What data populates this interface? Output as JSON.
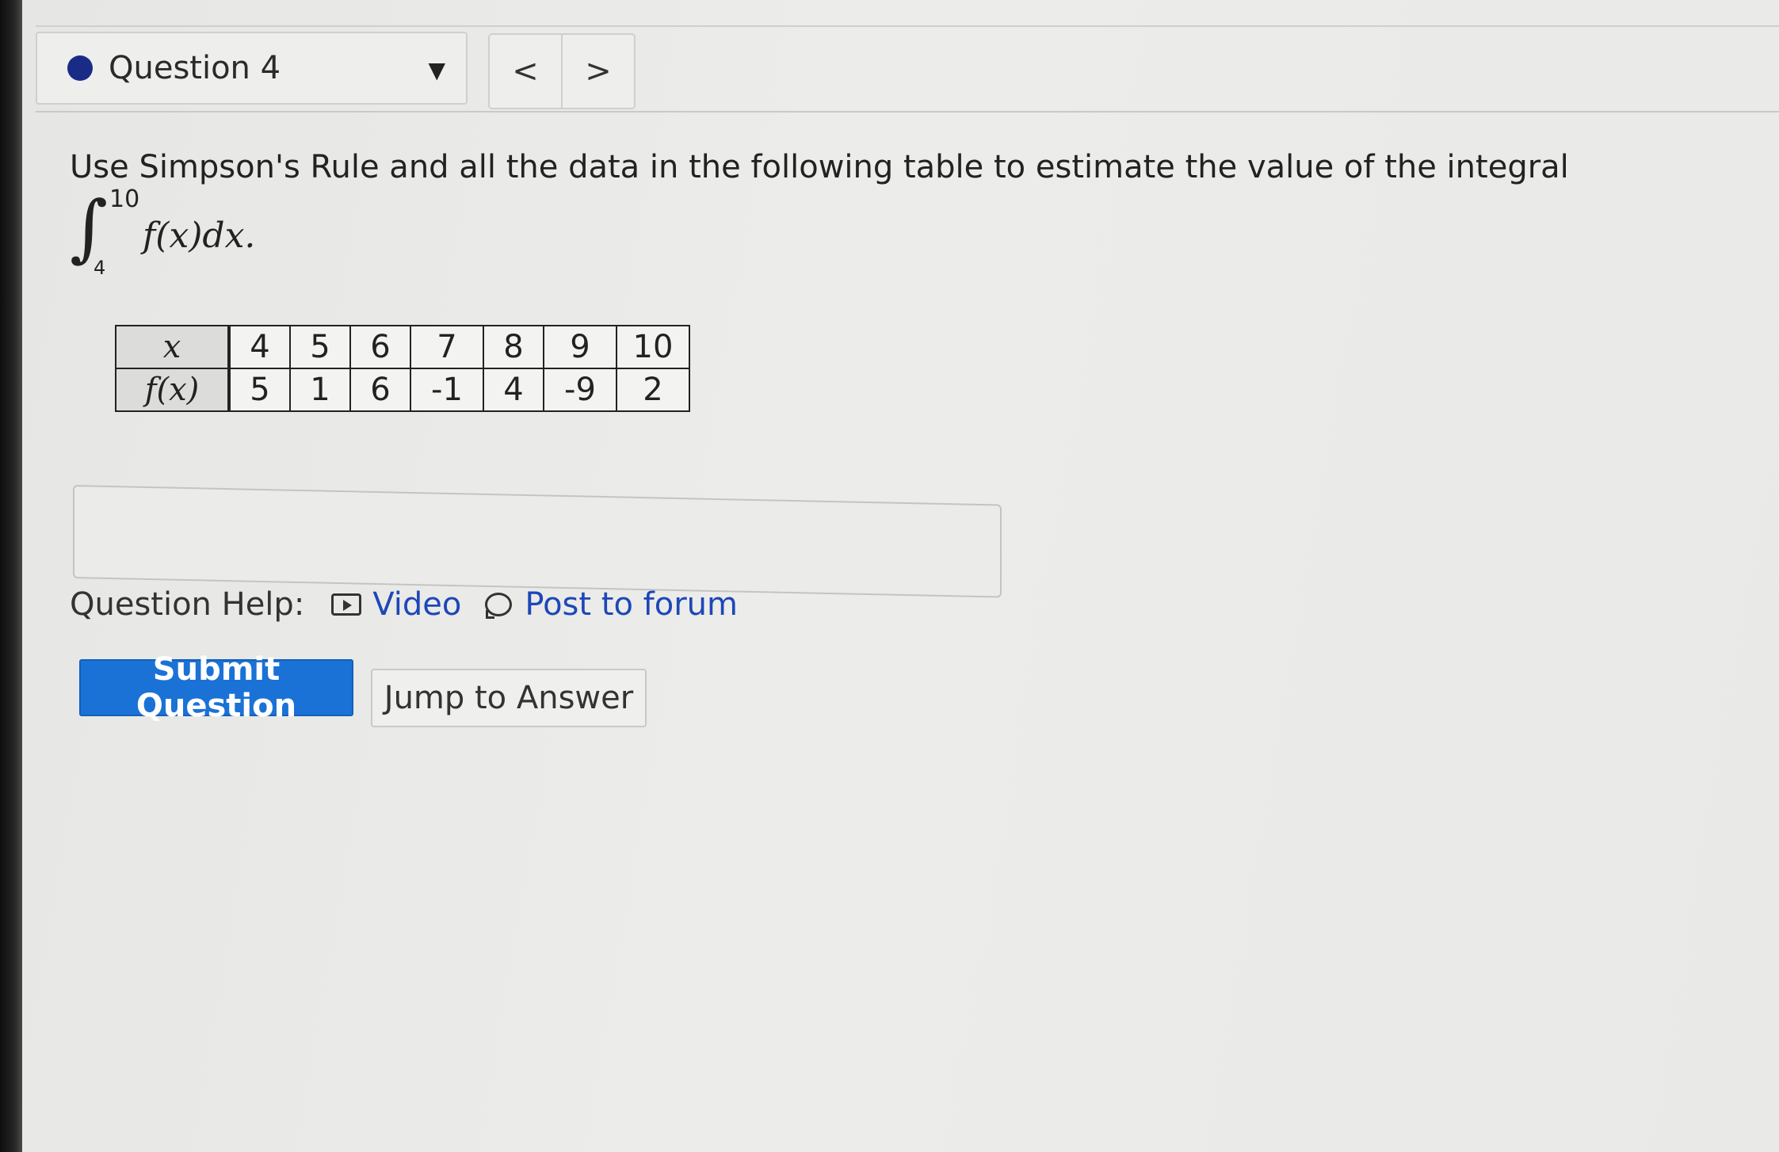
{
  "header": {
    "question_label": "Question 4",
    "dropdown_icon": "caret-down-icon",
    "prev_glyph": "<",
    "next_glyph": ">",
    "accent_dot_color": "#1a2b87"
  },
  "question": {
    "text": "Use Simpson's Rule and all the data in the following table to estimate the value of the integral",
    "integral": {
      "sign": "∫",
      "upper": "10",
      "lower": "4",
      "expression": "f(x)dx."
    }
  },
  "table": {
    "row_x_label": "x",
    "row_fx_label": "f(x)",
    "x": [
      "4",
      "5",
      "6",
      "7",
      "8",
      "9",
      "10"
    ],
    "fx": [
      "5",
      "1",
      "6",
      "-1",
      "4",
      "-9",
      "2"
    ]
  },
  "answer": {
    "value": ""
  },
  "help": {
    "label": "Question Help:",
    "video_label": "Video",
    "forum_label": "Post to forum"
  },
  "actions": {
    "submit_label": "Submit Question",
    "submit_color": "#1a72d6",
    "jump_label": "Jump to Answer"
  }
}
